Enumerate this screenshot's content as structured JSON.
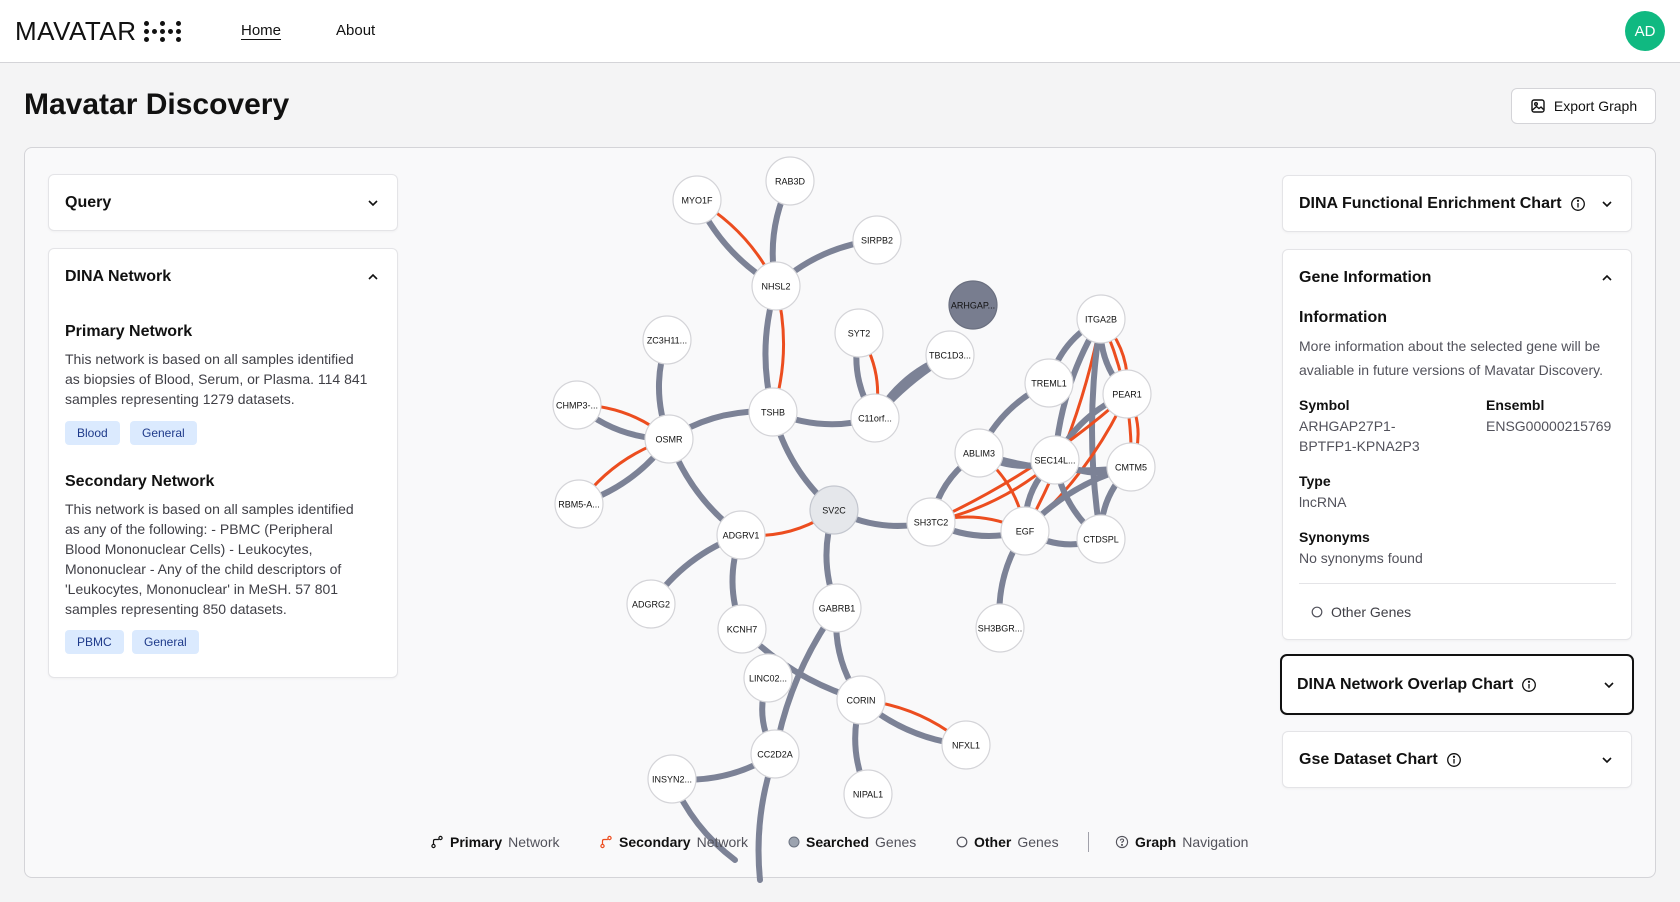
{
  "header": {
    "brand": "MAVATAR",
    "nav": [
      {
        "label": "Home"
      },
      {
        "label": "About"
      }
    ],
    "avatar_initials": "AD"
  },
  "page": {
    "title": "Mavatar Discovery",
    "export_label": "Export Graph"
  },
  "left": {
    "query_title": "Query",
    "dina_title": "DINA Network",
    "primary": {
      "title": "Primary Network",
      "lines": [
        "This network is based on all samples identified",
        "as biopsies of Blood, Serum, or Plasma. 114 841",
        "samples representing 1279 datasets."
      ],
      "tags": [
        "Blood",
        "General"
      ]
    },
    "secondary": {
      "title": "Secondary Network",
      "lines": [
        "This network is based on all samples identified",
        "as any of the following: - PBMC (Peripheral",
        "Blood Mononuclear Cells) - Leukocytes,",
        "Mononuclear - Any of the child descriptors of",
        "'Leukocytes, Mononuclear' in MeSH. 57 801",
        "samples representing 850 datasets."
      ],
      "tags": [
        "PBMC",
        "General"
      ]
    }
  },
  "right": {
    "enrichment_title": "DINA Functional Enrichment Chart",
    "gene_info_title": "Gene Information",
    "info_heading": "Information",
    "info_lines": [
      "More information about the selected gene will be",
      "avaliable in future versions of Mavatar Discovery."
    ],
    "symbol_label": "Symbol",
    "symbol_lines": [
      "ARHGAP27P1-",
      "BPTFP1-KPNA2P3"
    ],
    "ensembl_label": "Ensembl",
    "ensembl_value": "ENSG00000215769",
    "type_label": "Type",
    "type_value": "lncRNA",
    "synonyms_label": "Synonyms",
    "synonyms_value": "No synonyms found",
    "other_genes": "Other Genes",
    "overlap_title": "DINA Network Overlap Chart",
    "gse_title": "Gse Dataset Chart"
  },
  "legend": {
    "primary_bold": "Primary",
    "primary_rest": "Network",
    "secondary_bold": "Secondary",
    "secondary_rest": "Network",
    "searched_bold": "Searched",
    "searched_rest": "Genes",
    "other_bold": "Other",
    "other_rest": "Genes",
    "nav_bold": "Graph",
    "nav_rest": "Navigation"
  },
  "colors": {
    "primary_edge": "#7c8296",
    "secondary_edge": "#ec4d1f",
    "accent": "#10b981",
    "selected_node": "#787d8f",
    "searched_node": "#e5e7eb"
  },
  "graph": {
    "nodes": [
      {
        "id": "MYO1F",
        "label": "MYO1F",
        "kind": "other"
      },
      {
        "id": "RAB3D",
        "label": "RAB3D",
        "kind": "other"
      },
      {
        "id": "SIRPB2",
        "label": "SIRPB2",
        "kind": "other"
      },
      {
        "id": "NHSL2",
        "label": "NHSL2",
        "kind": "other"
      },
      {
        "id": "ARHGAP",
        "label": "ARHGAP...",
        "kind": "selected"
      },
      {
        "id": "ZC3H11",
        "label": "ZC3H11...",
        "kind": "other"
      },
      {
        "id": "SYT2",
        "label": "SYT2",
        "kind": "other"
      },
      {
        "id": "TBC1D3",
        "label": "TBC1D3...",
        "kind": "other"
      },
      {
        "id": "ITGA2B",
        "label": "ITGA2B",
        "kind": "other"
      },
      {
        "id": "CHMP3",
        "label": "CHMP3-...",
        "kind": "other"
      },
      {
        "id": "TSHB",
        "label": "TSHB",
        "kind": "other"
      },
      {
        "id": "C11orf",
        "label": "C11orf...",
        "kind": "other"
      },
      {
        "id": "TREML1",
        "label": "TREML1",
        "kind": "other"
      },
      {
        "id": "PEAR1",
        "label": "PEAR1",
        "kind": "other"
      },
      {
        "id": "OSMR",
        "label": "OSMR",
        "kind": "other"
      },
      {
        "id": "ABLIM3",
        "label": "ABLIM3",
        "kind": "other"
      },
      {
        "id": "SEC14L",
        "label": "SEC14L...",
        "kind": "other"
      },
      {
        "id": "CMTM5",
        "label": "CMTM5",
        "kind": "other"
      },
      {
        "id": "RBM5",
        "label": "RBM5-A...",
        "kind": "other"
      },
      {
        "id": "SV2C",
        "label": "SV2C",
        "kind": "searched"
      },
      {
        "id": "SH3TC2",
        "label": "SH3TC2",
        "kind": "other"
      },
      {
        "id": "EGF",
        "label": "EGF",
        "kind": "other"
      },
      {
        "id": "ADGRV1",
        "label": "ADGRV1",
        "kind": "other"
      },
      {
        "id": "CTDSPL",
        "label": "CTDSPL",
        "kind": "other"
      },
      {
        "id": "ADGRG2",
        "label": "ADGRG2",
        "kind": "other"
      },
      {
        "id": "GABRB1",
        "label": "GABRB1",
        "kind": "other"
      },
      {
        "id": "KCNH7",
        "label": "KCNH7",
        "kind": "other"
      },
      {
        "id": "SH3BGR",
        "label": "SH3BGR...",
        "kind": "other"
      },
      {
        "id": "LINC02",
        "label": "LINC02...",
        "kind": "other"
      },
      {
        "id": "CORIN",
        "label": "CORIN",
        "kind": "other"
      },
      {
        "id": "NFXL1",
        "label": "NFXL1",
        "kind": "other"
      },
      {
        "id": "CC2D2A",
        "label": "CC2D2A",
        "kind": "other"
      },
      {
        "id": "INSYN2",
        "label": "INSYN2...",
        "kind": "other"
      },
      {
        "id": "NIPAL1",
        "label": "NIPAL1",
        "kind": "other"
      }
    ],
    "edges": [
      {
        "a": "MYO1F",
        "b": "NHSL2",
        "t": "p"
      },
      {
        "a": "MYO1F",
        "b": "NHSL2",
        "t": "s"
      },
      {
        "a": "RAB3D",
        "b": "NHSL2",
        "t": "p"
      },
      {
        "a": "SIRPB2",
        "b": "NHSL2",
        "t": "p"
      },
      {
        "a": "NHSL2",
        "b": "TSHB",
        "t": "p"
      },
      {
        "a": "NHSL2",
        "b": "TSHB",
        "t": "s"
      },
      {
        "a": "SYT2",
        "b": "C11orf",
        "t": "p"
      },
      {
        "a": "SYT2",
        "b": "C11orf",
        "t": "s"
      },
      {
        "a": "TBC1D3",
        "b": "C11orf",
        "t": "p"
      },
      {
        "a": "TBC1D3",
        "b": "C11orf",
        "t": "p2"
      },
      {
        "a": "TSHB",
        "b": "C11orf",
        "t": "p"
      },
      {
        "a": "TSHB",
        "b": "OSMR",
        "t": "p"
      },
      {
        "a": "TSHB",
        "b": "SV2C",
        "t": "p"
      },
      {
        "a": "ZC3H11",
        "b": "OSMR",
        "t": "p"
      },
      {
        "a": "CHMP3",
        "b": "OSMR",
        "t": "p"
      },
      {
        "a": "CHMP3",
        "b": "OSMR",
        "t": "s"
      },
      {
        "a": "RBM5",
        "b": "OSMR",
        "t": "p"
      },
      {
        "a": "RBM5",
        "b": "OSMR",
        "t": "s"
      },
      {
        "a": "OSMR",
        "b": "ADGRV1",
        "t": "p"
      },
      {
        "a": "SV2C",
        "b": "ADGRV1",
        "t": "s"
      },
      {
        "a": "SV2C",
        "b": "SH3TC2",
        "t": "p"
      },
      {
        "a": "SV2C",
        "b": "GABRB1",
        "t": "p"
      },
      {
        "a": "ADGRV1",
        "b": "ADGRG2",
        "t": "p"
      },
      {
        "a": "ADGRV1",
        "b": "KCNH7",
        "t": "p"
      },
      {
        "a": "KCNH7",
        "b": "CORIN",
        "t": "p"
      },
      {
        "a": "GABRB1",
        "b": "CORIN",
        "t": "p"
      },
      {
        "a": "GABRB1",
        "b": "CC2D2A",
        "t": "p"
      },
      {
        "a": "LINC02",
        "b": "CC2D2A",
        "t": "p"
      },
      {
        "a": "CORIN",
        "b": "NFXL1",
        "t": "p"
      },
      {
        "a": "CORIN",
        "b": "NFXL1",
        "t": "s"
      },
      {
        "a": "CORIN",
        "b": "NIPAL1",
        "t": "p"
      },
      {
        "a": "INSYN2",
        "b": "CC2D2A",
        "t": "p"
      },
      {
        "a": "ITGA2B",
        "b": "TREML1",
        "t": "p"
      },
      {
        "a": "ITGA2B",
        "b": "PEAR1",
        "t": "p"
      },
      {
        "a": "ITGA2B",
        "b": "PEAR1",
        "t": "s"
      },
      {
        "a": "ITGA2B",
        "b": "SEC14L",
        "t": "p"
      },
      {
        "a": "ITGA2B",
        "b": "CMTM5",
        "t": "s"
      },
      {
        "a": "ITGA2B",
        "b": "EGF",
        "t": "s"
      },
      {
        "a": "ITGA2B",
        "b": "CTDSPL",
        "t": "p"
      },
      {
        "a": "TREML1",
        "b": "ABLIM3",
        "t": "p"
      },
      {
        "a": "PEAR1",
        "b": "SEC14L",
        "t": "p"
      },
      {
        "a": "PEAR1",
        "b": "CMTM5",
        "t": "s"
      },
      {
        "a": "PEAR1",
        "b": "EGF",
        "t": "s"
      },
      {
        "a": "PEAR1",
        "b": "SH3TC2",
        "t": "s"
      },
      {
        "a": "ABLIM3",
        "b": "SEC14L",
        "t": "p"
      },
      {
        "a": "ABLIM3",
        "b": "EGF",
        "t": "s"
      },
      {
        "a": "ABLIM3",
        "b": "SH3TC2",
        "t": "p"
      },
      {
        "a": "ABLIM3",
        "b": "CMTM5",
        "t": "p"
      },
      {
        "a": "SEC14L",
        "b": "CMTM5",
        "t": "p"
      },
      {
        "a": "SEC14L",
        "b": "EGF",
        "t": "p"
      },
      {
        "a": "SEC14L",
        "b": "SH3TC2",
        "t": "s"
      },
      {
        "a": "SEC14L",
        "b": "CTDSPL",
        "t": "p"
      },
      {
        "a": "CMTM5",
        "b": "EGF",
        "t": "p"
      },
      {
        "a": "CMTM5",
        "b": "CTDSPL",
        "t": "p"
      },
      {
        "a": "SH3TC2",
        "b": "EGF",
        "t": "p"
      },
      {
        "a": "SH3TC2",
        "b": "EGF",
        "t": "s"
      },
      {
        "a": "EGF",
        "b": "SH3BGR",
        "t": "p"
      },
      {
        "a": "EGF",
        "b": "CTDSPL",
        "t": "p"
      }
    ]
  }
}
